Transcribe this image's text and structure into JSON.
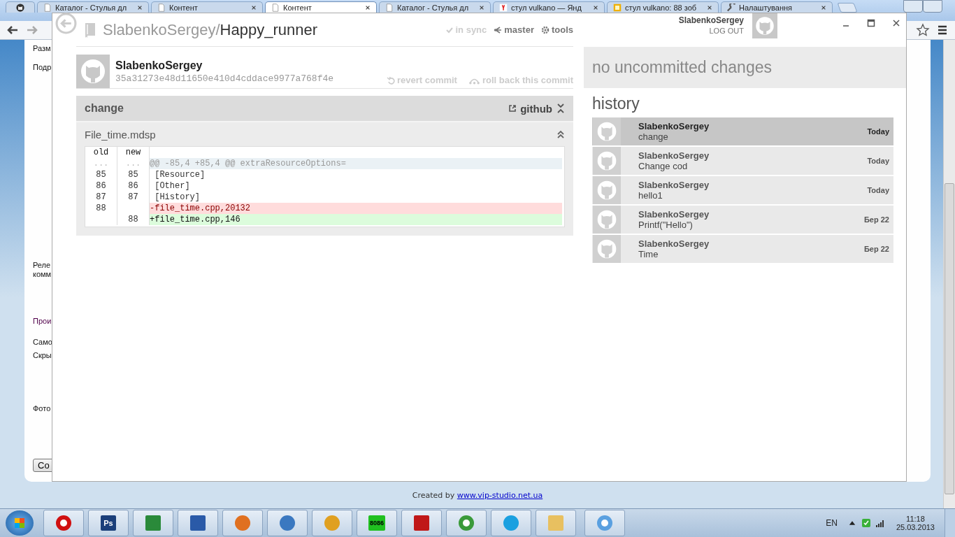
{
  "browser": {
    "tabs": [
      {
        "kind": "pinned",
        "selected": false
      },
      {
        "kind": "page",
        "label": "Каталог - Стулья дл",
        "selected": false
      },
      {
        "kind": "page",
        "label": "Контент",
        "selected": false
      },
      {
        "kind": "page",
        "label": "Контент",
        "selected": true
      },
      {
        "kind": "page",
        "label": "Каталог - Стулья дл",
        "selected": false
      },
      {
        "kind": "yandex",
        "label": "стул vulkano — Янд",
        "selected": false
      },
      {
        "kind": "images",
        "label": "стул vulkano: 88 зоб",
        "selected": false
      },
      {
        "kind": "settings",
        "label": "Налаштування",
        "selected": false
      }
    ]
  },
  "page": {
    "labels": [
      {
        "text": "Разм",
        "kind": "label"
      },
      {
        "text": "Подр",
        "kind": "label"
      },
      {
        "text": "Реле",
        "kind": "label"
      },
      {
        "text": "комм",
        "kind": "label"
      },
      {
        "text": "Прои",
        "kind": "link"
      },
      {
        "text": "Само",
        "kind": "label"
      },
      {
        "text": "Скры",
        "kind": "label"
      },
      {
        "text": "Фото",
        "kind": "label"
      }
    ],
    "button": "Со",
    "footer": {
      "text": "Created by ",
      "link": "www.vip-studio.net.ua"
    }
  },
  "app": {
    "owner": "SlabenkoSergey/",
    "repo": "Happy_runner",
    "status": [
      {
        "kind": "sync",
        "label": "in sync"
      },
      {
        "kind": "branch",
        "label": "master"
      },
      {
        "kind": "tools",
        "label": "tools"
      }
    ],
    "account": {
      "name": "SlabenkoSergey",
      "logout": "LOG OUT"
    },
    "commit": {
      "author": "SlabenkoSergey",
      "sha": "35a31273e48d11650e410d4cddace9977a768f4e",
      "actions": [
        {
          "kind": "revert",
          "label": "revert commit"
        },
        {
          "kind": "rollback",
          "label": "roll back this commit"
        }
      ],
      "message": "change",
      "link": "github",
      "file": {
        "name": "File_time.mdsp",
        "columns": [
          "old",
          "new"
        ],
        "rows": [
          {
            "kind": "hunk",
            "old": "...",
            "new": "...",
            "text": "@@ -85,4 +85,4 @@ extraResourceOptions="
          },
          {
            "kind": "context",
            "old": "85",
            "new": "85",
            "text": " [Resource]"
          },
          {
            "kind": "context",
            "old": "86",
            "new": "86",
            "text": " [Other]"
          },
          {
            "kind": "context",
            "old": "87",
            "new": "87",
            "text": " [History]"
          },
          {
            "kind": "del",
            "old": "88",
            "new": "",
            "text": "-file_time.cpp,20132"
          },
          {
            "kind": "add",
            "old": "",
            "new": "88",
            "text": "+file_time.cpp,146"
          }
        ]
      }
    },
    "changes": "no uncommitted changes",
    "history_title": "history",
    "history": [
      {
        "author": "SlabenkoSergey",
        "message": "change",
        "date": "Today",
        "selected": true
      },
      {
        "author": "SlabenkoSergey",
        "message": "Change cod",
        "date": "Today",
        "selected": false
      },
      {
        "author": "SlabenkoSergey",
        "message": "hello1",
        "date": "Today",
        "selected": false
      },
      {
        "author": "SlabenkoSergey",
        "message": "Printf(\"Hello\")",
        "date": "Бер 22",
        "selected": false
      },
      {
        "author": "SlabenkoSergey",
        "message": "Time",
        "date": "Бер 22",
        "selected": false
      }
    ]
  },
  "taskbar": {
    "apps": [
      {
        "kind": "opera"
      },
      {
        "kind": "photoshop",
        "label": "Ps"
      },
      {
        "kind": "excel"
      },
      {
        "kind": "word"
      },
      {
        "kind": "firefox"
      },
      {
        "kind": "player"
      },
      {
        "kind": "winamp"
      },
      {
        "kind": "chip",
        "label": "8086"
      },
      {
        "kind": "pdf"
      },
      {
        "kind": "chrome"
      },
      {
        "kind": "skype"
      },
      {
        "kind": "folder"
      },
      {
        "kind": "github"
      }
    ],
    "language": "EN",
    "time": "11:18",
    "date": "25.03.2013"
  }
}
